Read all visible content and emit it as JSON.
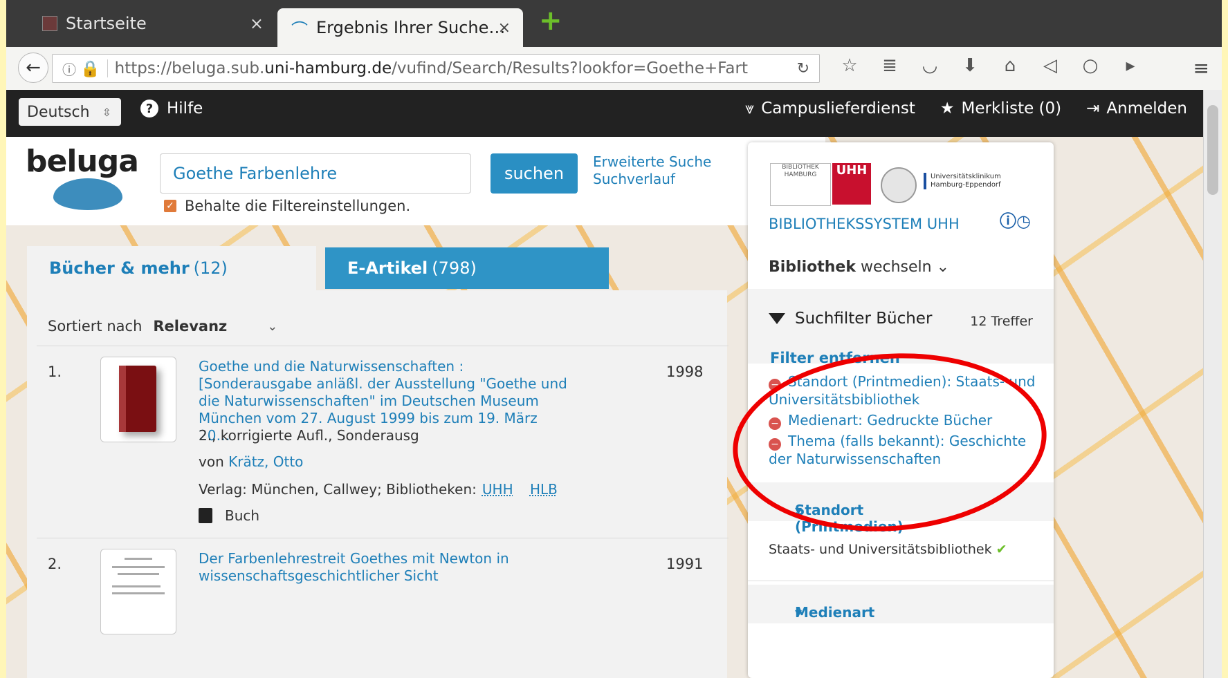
{
  "browser": {
    "tabs": [
      {
        "label": "Startseite"
      },
      {
        "label": "Ergebnis Ihrer Suche…"
      }
    ],
    "close_glyph": "×",
    "new_tab_glyph": "+",
    "url_prefix": "https://beluga.sub.",
    "url_domain": "uni-hamburg.de",
    "url_rest": "/vufind/Search/Results?lookfor=Goethe+Fart",
    "icons": [
      "bookmark-star-icon",
      "reading-list-icon",
      "pocket-icon",
      "download-icon",
      "home-icon",
      "send-icon",
      "chat-icon",
      "extension-icon"
    ]
  },
  "topbar": {
    "language": "Deutsch",
    "help": "Hilfe",
    "campus": "Campuslieferdienst",
    "merkliste": "Merkliste (0)",
    "login": "Anmelden"
  },
  "header": {
    "logo": "beluga",
    "search_value": "Goethe Farbenlehre",
    "search_button": "suchen",
    "advanced": "Erweiterte Suche",
    "history": "Suchverlauf",
    "keep_filters": "Behalte die Filtereinstellungen."
  },
  "result_tabs": [
    {
      "label": "Bücher & mehr",
      "count": "(12)"
    },
    {
      "label": "E-Artikel",
      "count": "(798)"
    }
  ],
  "sort": {
    "label": "Sortiert nach",
    "value": "Relevanz"
  },
  "results": [
    {
      "num": "1.",
      "title": "Goethe und die Naturwissenschaften : [Sonderausgabe anläßl. der Ausstellung \"Goethe und die Naturwissenschaften\" im Deutschen Museum München vom 27. August 1999 bis zum 19. März 20…",
      "year": "1998",
      "edition": "2., korrigierte Aufl., Sonderausg",
      "by_label": "von",
      "author": "Krätz, Otto",
      "pub_label": "Verlag: München, Callwey; Bibliotheken:",
      "libs": [
        "UHH",
        "HLB"
      ],
      "type": "Buch"
    },
    {
      "num": "2.",
      "title": "Der Farbenlehrestreit Goethes mit Newton in wissenschaftsgeschichtlicher Sicht",
      "year": "1991"
    }
  ],
  "side": {
    "crest_text": "BIBLIOTHEK HAMBURG",
    "uhh": "UHH",
    "uke": "Universitätsklinikum Hamburg-Eppendorf",
    "library_name": "BIBLIOTHEKSSYSTEM UHH",
    "switch_bold": "Bibliothek",
    "switch_rest": "wechseln",
    "filter_title": "Suchfilter Bücher",
    "hits": "12 Treffer",
    "remove_filters": "Filter entfernen",
    "active_filters": [
      "Standort (Printmedien): Staats- und Universitätsbibliothek",
      "Medienart: Gedruckte Bücher",
      "Thema (falls bekannt): Geschichte der Naturwissenschaften"
    ],
    "facet1": "Standort (Printmedien)",
    "facet1_item": "Staats- und Universitätsbibliothek",
    "facet2": "Medienart"
  },
  "colors": {
    "accent": "#1e7fb8",
    "button": "#2a8fc3",
    "annotation": "#e00000"
  }
}
